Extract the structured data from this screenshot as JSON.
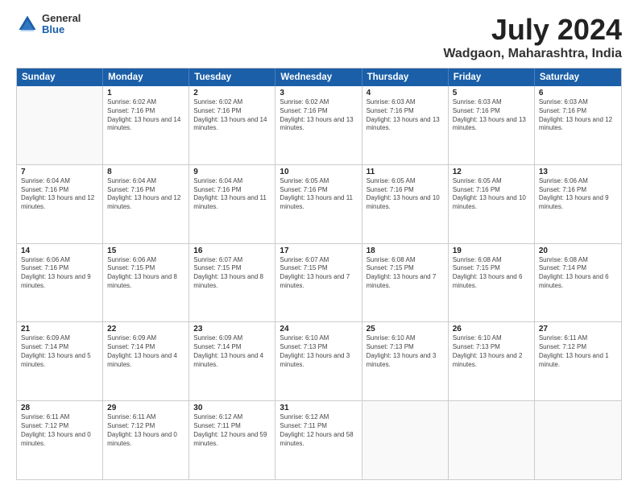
{
  "logo": {
    "general": "General",
    "blue": "Blue"
  },
  "title": "July 2024",
  "location": "Wadgaon, Maharashtra, India",
  "header_days": [
    "Sunday",
    "Monday",
    "Tuesday",
    "Wednesday",
    "Thursday",
    "Friday",
    "Saturday"
  ],
  "weeks": [
    [
      {
        "day": "",
        "empty": true
      },
      {
        "day": "1",
        "sunrise": "6:02 AM",
        "sunset": "7:16 PM",
        "daylight": "13 hours and 14 minutes."
      },
      {
        "day": "2",
        "sunrise": "6:02 AM",
        "sunset": "7:16 PM",
        "daylight": "13 hours and 14 minutes."
      },
      {
        "day": "3",
        "sunrise": "6:02 AM",
        "sunset": "7:16 PM",
        "daylight": "13 hours and 13 minutes."
      },
      {
        "day": "4",
        "sunrise": "6:03 AM",
        "sunset": "7:16 PM",
        "daylight": "13 hours and 13 minutes."
      },
      {
        "day": "5",
        "sunrise": "6:03 AM",
        "sunset": "7:16 PM",
        "daylight": "13 hours and 13 minutes."
      },
      {
        "day": "6",
        "sunrise": "6:03 AM",
        "sunset": "7:16 PM",
        "daylight": "13 hours and 12 minutes."
      }
    ],
    [
      {
        "day": "7",
        "sunrise": "6:04 AM",
        "sunset": "7:16 PM",
        "daylight": "13 hours and 12 minutes."
      },
      {
        "day": "8",
        "sunrise": "6:04 AM",
        "sunset": "7:16 PM",
        "daylight": "13 hours and 12 minutes."
      },
      {
        "day": "9",
        "sunrise": "6:04 AM",
        "sunset": "7:16 PM",
        "daylight": "13 hours and 11 minutes."
      },
      {
        "day": "10",
        "sunrise": "6:05 AM",
        "sunset": "7:16 PM",
        "daylight": "13 hours and 11 minutes."
      },
      {
        "day": "11",
        "sunrise": "6:05 AM",
        "sunset": "7:16 PM",
        "daylight": "13 hours and 10 minutes."
      },
      {
        "day": "12",
        "sunrise": "6:05 AM",
        "sunset": "7:16 PM",
        "daylight": "13 hours and 10 minutes."
      },
      {
        "day": "13",
        "sunrise": "6:06 AM",
        "sunset": "7:16 PM",
        "daylight": "13 hours and 9 minutes."
      }
    ],
    [
      {
        "day": "14",
        "sunrise": "6:06 AM",
        "sunset": "7:16 PM",
        "daylight": "13 hours and 9 minutes."
      },
      {
        "day": "15",
        "sunrise": "6:06 AM",
        "sunset": "7:15 PM",
        "daylight": "13 hours and 8 minutes."
      },
      {
        "day": "16",
        "sunrise": "6:07 AM",
        "sunset": "7:15 PM",
        "daylight": "13 hours and 8 minutes."
      },
      {
        "day": "17",
        "sunrise": "6:07 AM",
        "sunset": "7:15 PM",
        "daylight": "13 hours and 7 minutes."
      },
      {
        "day": "18",
        "sunrise": "6:08 AM",
        "sunset": "7:15 PM",
        "daylight": "13 hours and 7 minutes."
      },
      {
        "day": "19",
        "sunrise": "6:08 AM",
        "sunset": "7:15 PM",
        "daylight": "13 hours and 6 minutes."
      },
      {
        "day": "20",
        "sunrise": "6:08 AM",
        "sunset": "7:14 PM",
        "daylight": "13 hours and 6 minutes."
      }
    ],
    [
      {
        "day": "21",
        "sunrise": "6:09 AM",
        "sunset": "7:14 PM",
        "daylight": "13 hours and 5 minutes."
      },
      {
        "day": "22",
        "sunrise": "6:09 AM",
        "sunset": "7:14 PM",
        "daylight": "13 hours and 4 minutes."
      },
      {
        "day": "23",
        "sunrise": "6:09 AM",
        "sunset": "7:14 PM",
        "daylight": "13 hours and 4 minutes."
      },
      {
        "day": "24",
        "sunrise": "6:10 AM",
        "sunset": "7:13 PM",
        "daylight": "13 hours and 3 minutes."
      },
      {
        "day": "25",
        "sunrise": "6:10 AM",
        "sunset": "7:13 PM",
        "daylight": "13 hours and 3 minutes."
      },
      {
        "day": "26",
        "sunrise": "6:10 AM",
        "sunset": "7:13 PM",
        "daylight": "13 hours and 2 minutes."
      },
      {
        "day": "27",
        "sunrise": "6:11 AM",
        "sunset": "7:12 PM",
        "daylight": "13 hours and 1 minute."
      }
    ],
    [
      {
        "day": "28",
        "sunrise": "6:11 AM",
        "sunset": "7:12 PM",
        "daylight": "13 hours and 0 minutes."
      },
      {
        "day": "29",
        "sunrise": "6:11 AM",
        "sunset": "7:12 PM",
        "daylight": "13 hours and 0 minutes."
      },
      {
        "day": "30",
        "sunrise": "6:12 AM",
        "sunset": "7:11 PM",
        "daylight": "12 hours and 59 minutes."
      },
      {
        "day": "31",
        "sunrise": "6:12 AM",
        "sunset": "7:11 PM",
        "daylight": "12 hours and 58 minutes."
      },
      {
        "day": "",
        "empty": true
      },
      {
        "day": "",
        "empty": true
      },
      {
        "day": "",
        "empty": true
      }
    ]
  ]
}
